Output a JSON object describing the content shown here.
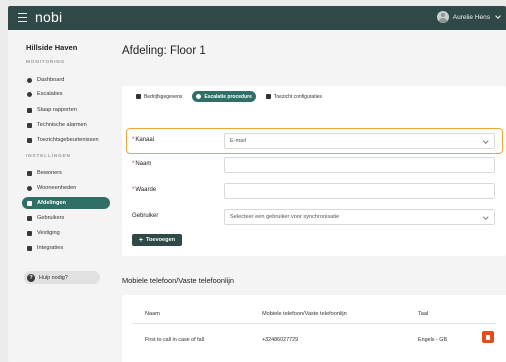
{
  "topbar": {
    "logo": "nobi",
    "user_name": "Aurelie Hens"
  },
  "sidebar": {
    "org": "Hillside Haven",
    "monitoring_label": "MONITORING",
    "monitoring_items": [
      {
        "label": "Dashboard",
        "icon": "dashboard-icon"
      },
      {
        "label": "Escalaties",
        "icon": "pin-icon"
      },
      {
        "label": "Slaap rapporten",
        "icon": "report-icon"
      },
      {
        "label": "Technische alarmen",
        "icon": "wrench-icon"
      },
      {
        "label": "Toezichtsgebeurtenissen",
        "icon": "monitor-icon"
      }
    ],
    "settings_label": "INSTELLINGEN",
    "settings_items": [
      {
        "label": "Bewoners",
        "icon": "residents-icon"
      },
      {
        "label": "Wooneenheden",
        "icon": "units-icon"
      },
      {
        "label": "Afdelingen",
        "icon": "departments-icon",
        "active": true
      },
      {
        "label": "Gebruikers",
        "icon": "users-icon"
      },
      {
        "label": "Vestiging",
        "icon": "home-icon"
      },
      {
        "label": "Integraties",
        "icon": "integrations-icon"
      }
    ],
    "help": "Hulp nodig?"
  },
  "page": {
    "title": "Afdeling: Floor 1"
  },
  "tabs": [
    {
      "label": "Bedrijfsgegevens",
      "active": false
    },
    {
      "label": "Escalatie procedure",
      "active": true
    },
    {
      "label": "Toezicht configuraties",
      "active": false
    }
  ],
  "form": {
    "kanaal_label": "Kanaal",
    "kanaal_value": "E-mail",
    "naam_label": "Naam",
    "waarde_label": "Waarde",
    "gebruiker_label": "Gebruiker",
    "gebruiker_placeholder": "Selecteer een gebruiker voor synchronisatie",
    "add_button": "Toevoegen"
  },
  "phones": {
    "title": "Mobiele telefoon/Vaste telefoonlijn",
    "headers": [
      "Naam",
      "Mobiele telefoon/Vaste telefoonlijn",
      "Taal"
    ],
    "rows": [
      {
        "name": "First to call in case of fall",
        "phone": "+32486027729",
        "language": "Engels - GB"
      }
    ]
  },
  "colors": {
    "topbar": "#2f4a46",
    "active": "#2f6f66",
    "highlight": "#f0a53a",
    "delete": "#e24e1b"
  }
}
